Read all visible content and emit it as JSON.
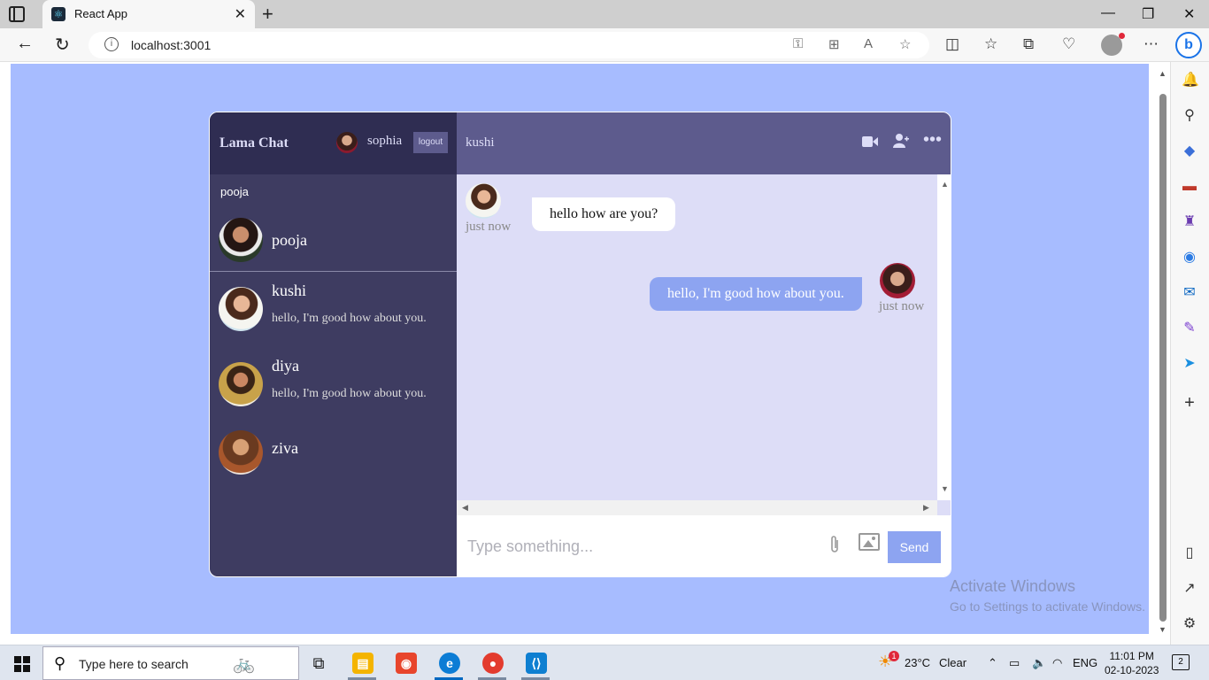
{
  "browser": {
    "tab_title": "React App",
    "url": "localhost:3001"
  },
  "app": {
    "logo": "Lama Chat",
    "current_user": "sophia",
    "logout_label": "logout",
    "search_value": "pooja",
    "search_result": {
      "name": "pooja"
    },
    "chats": [
      {
        "name": "kushi",
        "last_message": "hello, I'm good how about you."
      },
      {
        "name": "diya",
        "last_message": "hello, I'm good how about you."
      },
      {
        "name": "ziva",
        "last_message": ""
      }
    ],
    "active_chat": {
      "name": "kushi",
      "messages": [
        {
          "owner": false,
          "text": "hello how are you?",
          "time": "just now"
        },
        {
          "owner": true,
          "text": "hello, I'm good how about you.",
          "time": "just now"
        }
      ]
    },
    "input_placeholder": "Type something...",
    "send_label": "Send",
    "colors": {
      "page_bg": "#a7bcff",
      "sidebar_bg": "#3e3c61",
      "sidebar_nav_bg": "#2f2d52",
      "chat_nav_bg": "#5d5b8d",
      "messages_bg": "#ddddf7",
      "owner_bubble": "#8da4f1"
    }
  },
  "watermark": {
    "line1": "Activate Windows",
    "line2": "Go to Settings to activate Windows."
  },
  "taskbar": {
    "search_placeholder": "Type here to search",
    "weather_temp": "23°C",
    "weather_desc": "Clear",
    "language": "ENG",
    "time": "11:01 PM",
    "date": "02-10-2023",
    "notification_count": "2",
    "weather_badge": "1"
  }
}
